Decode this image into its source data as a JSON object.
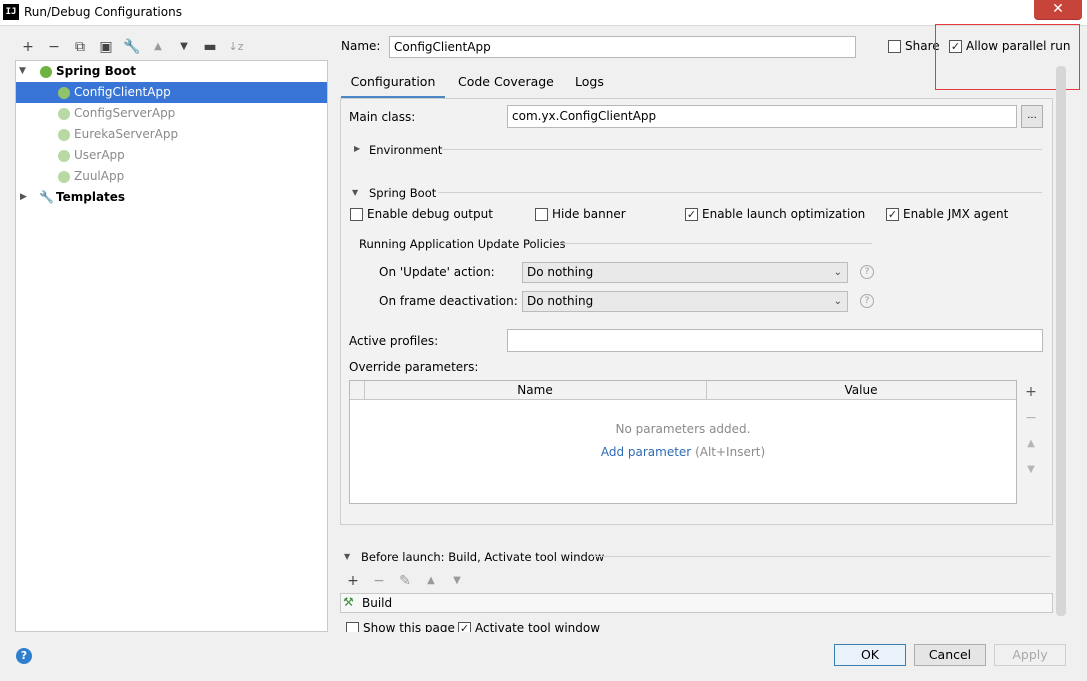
{
  "window": {
    "title": "Run/Debug Configurations",
    "app_icon": "IJ",
    "close": "✕"
  },
  "toolbar": {
    "icons": [
      "add-icon",
      "remove-icon",
      "copy-icon",
      "save-icon",
      "wrench-icon",
      "move-up-icon",
      "move-down-icon",
      "folder-add-icon",
      "sort-icon"
    ]
  },
  "tree": {
    "group": "Spring Boot",
    "items": [
      "ConfigClientApp",
      "ConfigServerApp",
      "EurekaServerApp",
      "UserApp",
      "ZuulApp"
    ],
    "templates": "Templates"
  },
  "header": {
    "name_label": "Name:",
    "name_value": "ConfigClientApp",
    "share_label": "Share",
    "allow_parallel_label": "Allow parallel run"
  },
  "tabs": [
    "Configuration",
    "Code Coverage",
    "Logs"
  ],
  "config": {
    "main_class_label": "Main class:",
    "main_class_value": "com.yx.ConfigClientApp",
    "browse_label": "...",
    "environment_label": "Environment",
    "spring_boot_label": "Spring Boot",
    "enable_debug_label": "Enable debug output",
    "hide_banner_label": "Hide banner",
    "launch_opt_label": "Enable launch optimization",
    "jmx_label": "Enable JMX agent",
    "policies_label": "Running Application Update Policies",
    "on_update_label": "On 'Update' action:",
    "on_update_value": "Do nothing",
    "on_frame_label": "On frame deactivation:",
    "on_frame_value": "Do nothing",
    "help_glyph": "?",
    "active_profiles_label": "Active profiles:",
    "active_profiles_value": "",
    "override_label": "Override parameters:",
    "col_name": "Name",
    "col_value": "Value",
    "empty_text": "No parameters added.",
    "add_param_link": "Add parameter",
    "add_param_hint": "(Alt+Insert)"
  },
  "before_launch": {
    "label": "Before launch: Build, Activate tool window",
    "build_item": "Build",
    "show_page_label": "Show this page",
    "activate_label": "Activate tool window"
  },
  "buttons": {
    "ok": "OK",
    "cancel": "Cancel",
    "apply": "Apply",
    "help": "?"
  },
  "checkbox_states": {
    "share": false,
    "allow_parallel": true,
    "debug": false,
    "hide_banner": false,
    "launch_opt": true,
    "jmx": true,
    "show_page": false,
    "activate": true
  }
}
